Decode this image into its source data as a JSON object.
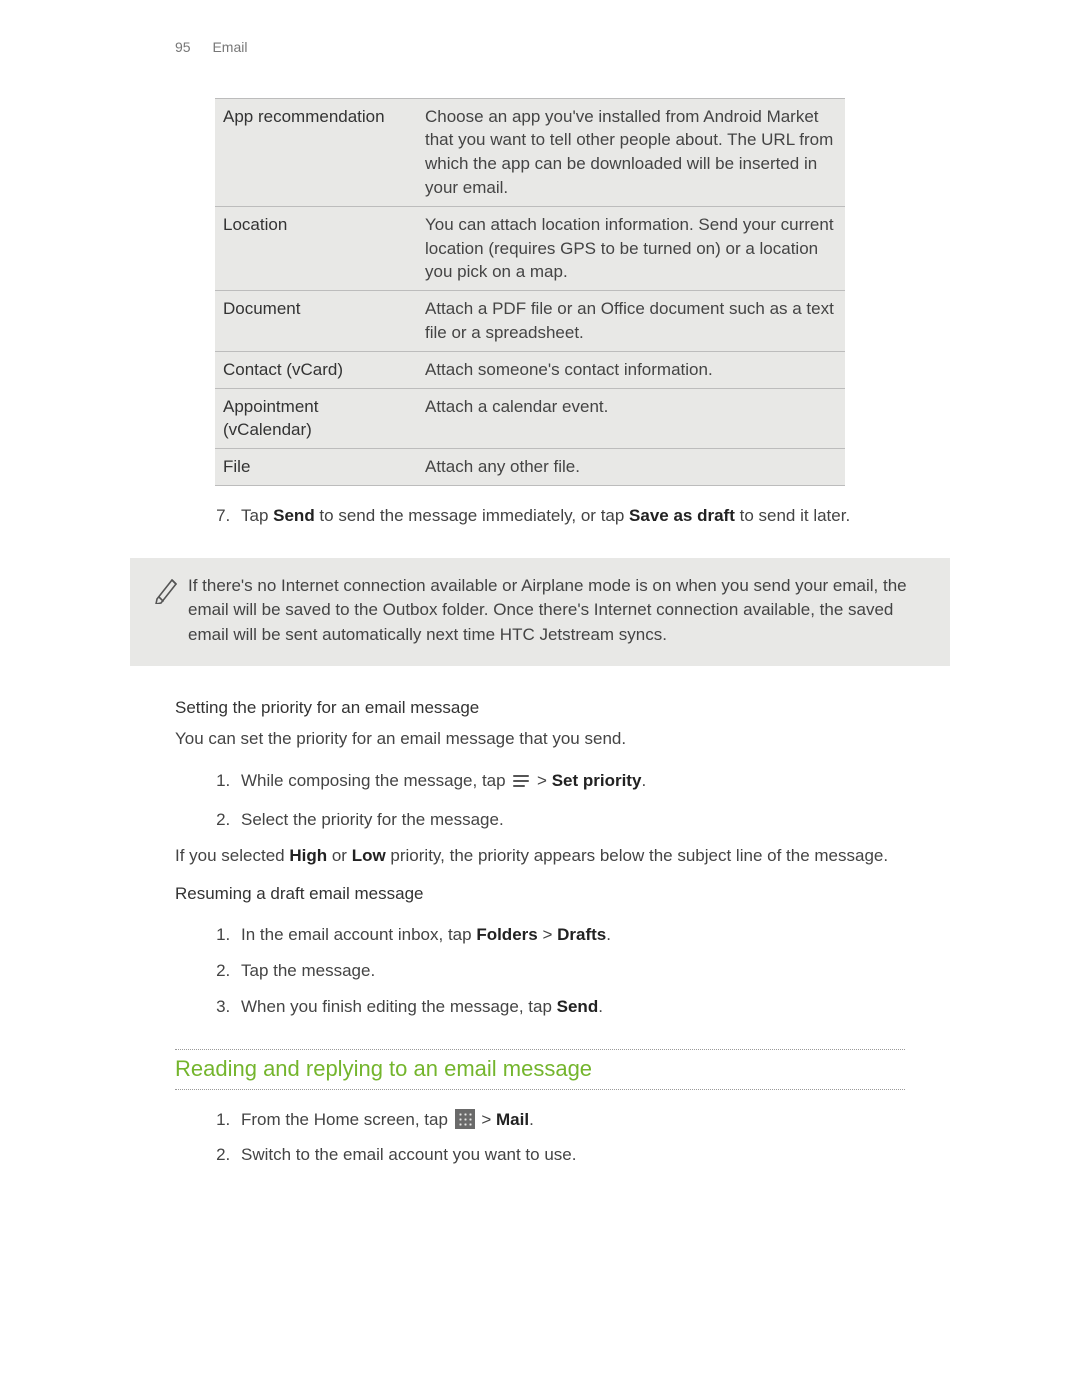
{
  "header": {
    "page_number": "95",
    "section": "Email"
  },
  "attach_table": [
    {
      "label": "App recommendation",
      "desc": "Choose an app you've installed from Android Market that you want to tell other people about. The URL from which the app can be downloaded will be inserted in your email."
    },
    {
      "label": "Location",
      "desc": "You can attach location information. Send your current location (requires GPS to be turned on) or a location you pick on a map."
    },
    {
      "label": "Document",
      "desc": "Attach a PDF file or an Office document such as a text file or a spreadsheet."
    },
    {
      "label": "Contact (vCard)",
      "desc": "Attach someone's contact information."
    },
    {
      "label": "Appointment (vCalendar)",
      "desc": "Attach a calendar event."
    },
    {
      "label": "File",
      "desc": "Attach any other file."
    }
  ],
  "step7": {
    "prefix": "Tap ",
    "send": "Send",
    "mid": " to send the message immediately, or tap ",
    "save": "Save as draft",
    "suffix": " to send it later."
  },
  "note_text": "If there's no Internet connection available or Airplane mode is on when you send your email, the email will be saved to the Outbox folder. Once there's Internet connection available, the saved email will be sent automatically next time HTC Jetstream syncs.",
  "priority": {
    "heading": "Setting the priority for an email message",
    "intro": "You can set the priority for an email message that you send.",
    "step1_prefix": "While composing the message, tap ",
    "step1_gt": " > ",
    "step1_bold": "Set priority",
    "step1_suffix": ".",
    "step2": "Select the priority for the message.",
    "outro_a": "If you selected ",
    "outro_high": "High",
    "outro_b": " or ",
    "outro_low": "Low",
    "outro_c": " priority, the priority appears below the subject line of the message."
  },
  "resume": {
    "heading": "Resuming a draft email message",
    "s1_a": "In the email account inbox, tap ",
    "s1_b": "Folders",
    "s1_c": " > ",
    "s1_d": "Drafts",
    "s1_e": ".",
    "s2": "Tap the message.",
    "s3_a": "When you finish editing the message, tap ",
    "s3_b": "Send",
    "s3_c": "."
  },
  "reading": {
    "title": "Reading and replying to an email message",
    "s1_a": "From the Home screen, tap ",
    "s1_b": " > ",
    "s1_c": "Mail",
    "s1_d": ".",
    "s2": "Switch to the email account you want to use."
  }
}
